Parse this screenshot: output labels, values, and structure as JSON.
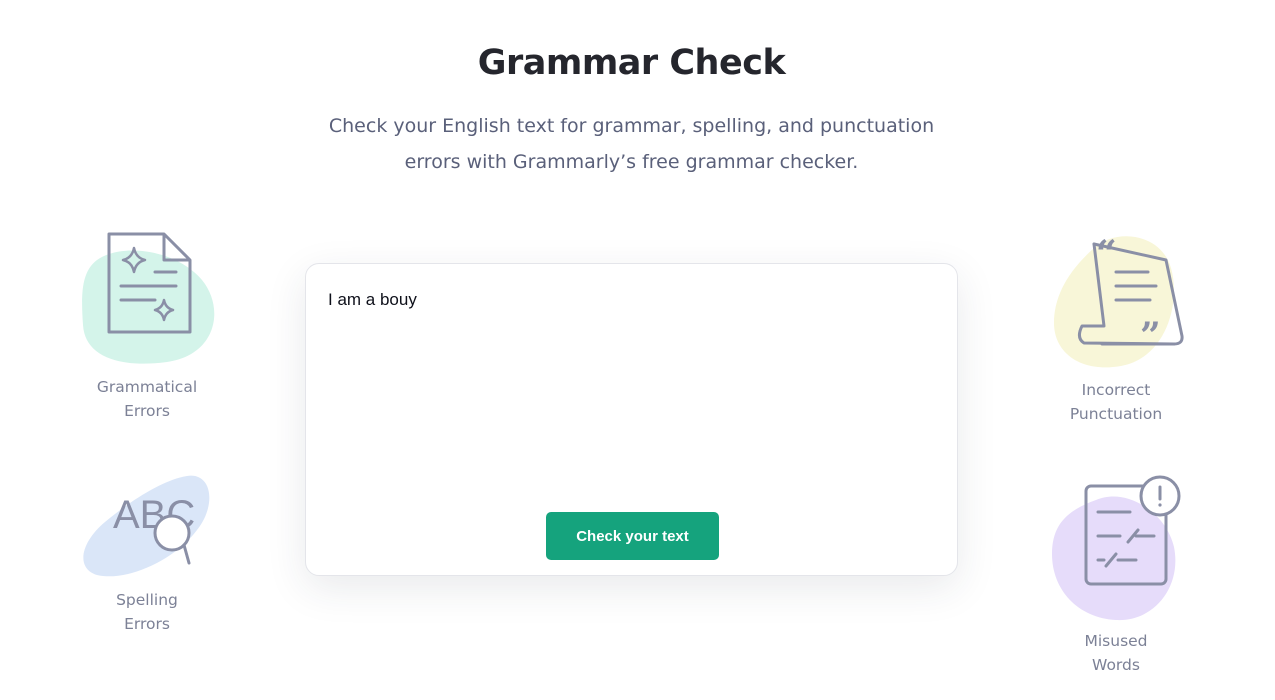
{
  "header": {
    "title": "Grammar Check",
    "subtitle_line1": "Check your English text for grammar, spelling, and punctuation",
    "subtitle_line2": "errors with Grammarly’s free grammar checker."
  },
  "editor": {
    "text": "I am a bouy",
    "button_label": "Check your text",
    "button_color": "#15a37d"
  },
  "features": [
    {
      "icon": "document-sparkle-icon",
      "line1": "Grammatical",
      "line2": "Errors",
      "blob_color": "#d4f4ea"
    },
    {
      "icon": "abc-magnifier-icon",
      "line1": "Spelling",
      "line2": "Errors",
      "blob_color": "#dae6f8"
    },
    {
      "icon": "quote-scroll-icon",
      "line1": "Incorrect",
      "line2": "Punctuation",
      "blob_color": "#f8f6d8"
    },
    {
      "icon": "misused-words-icon",
      "line1": "Misused",
      "line2": "Words",
      "blob_color": "#e6dcfa"
    }
  ]
}
